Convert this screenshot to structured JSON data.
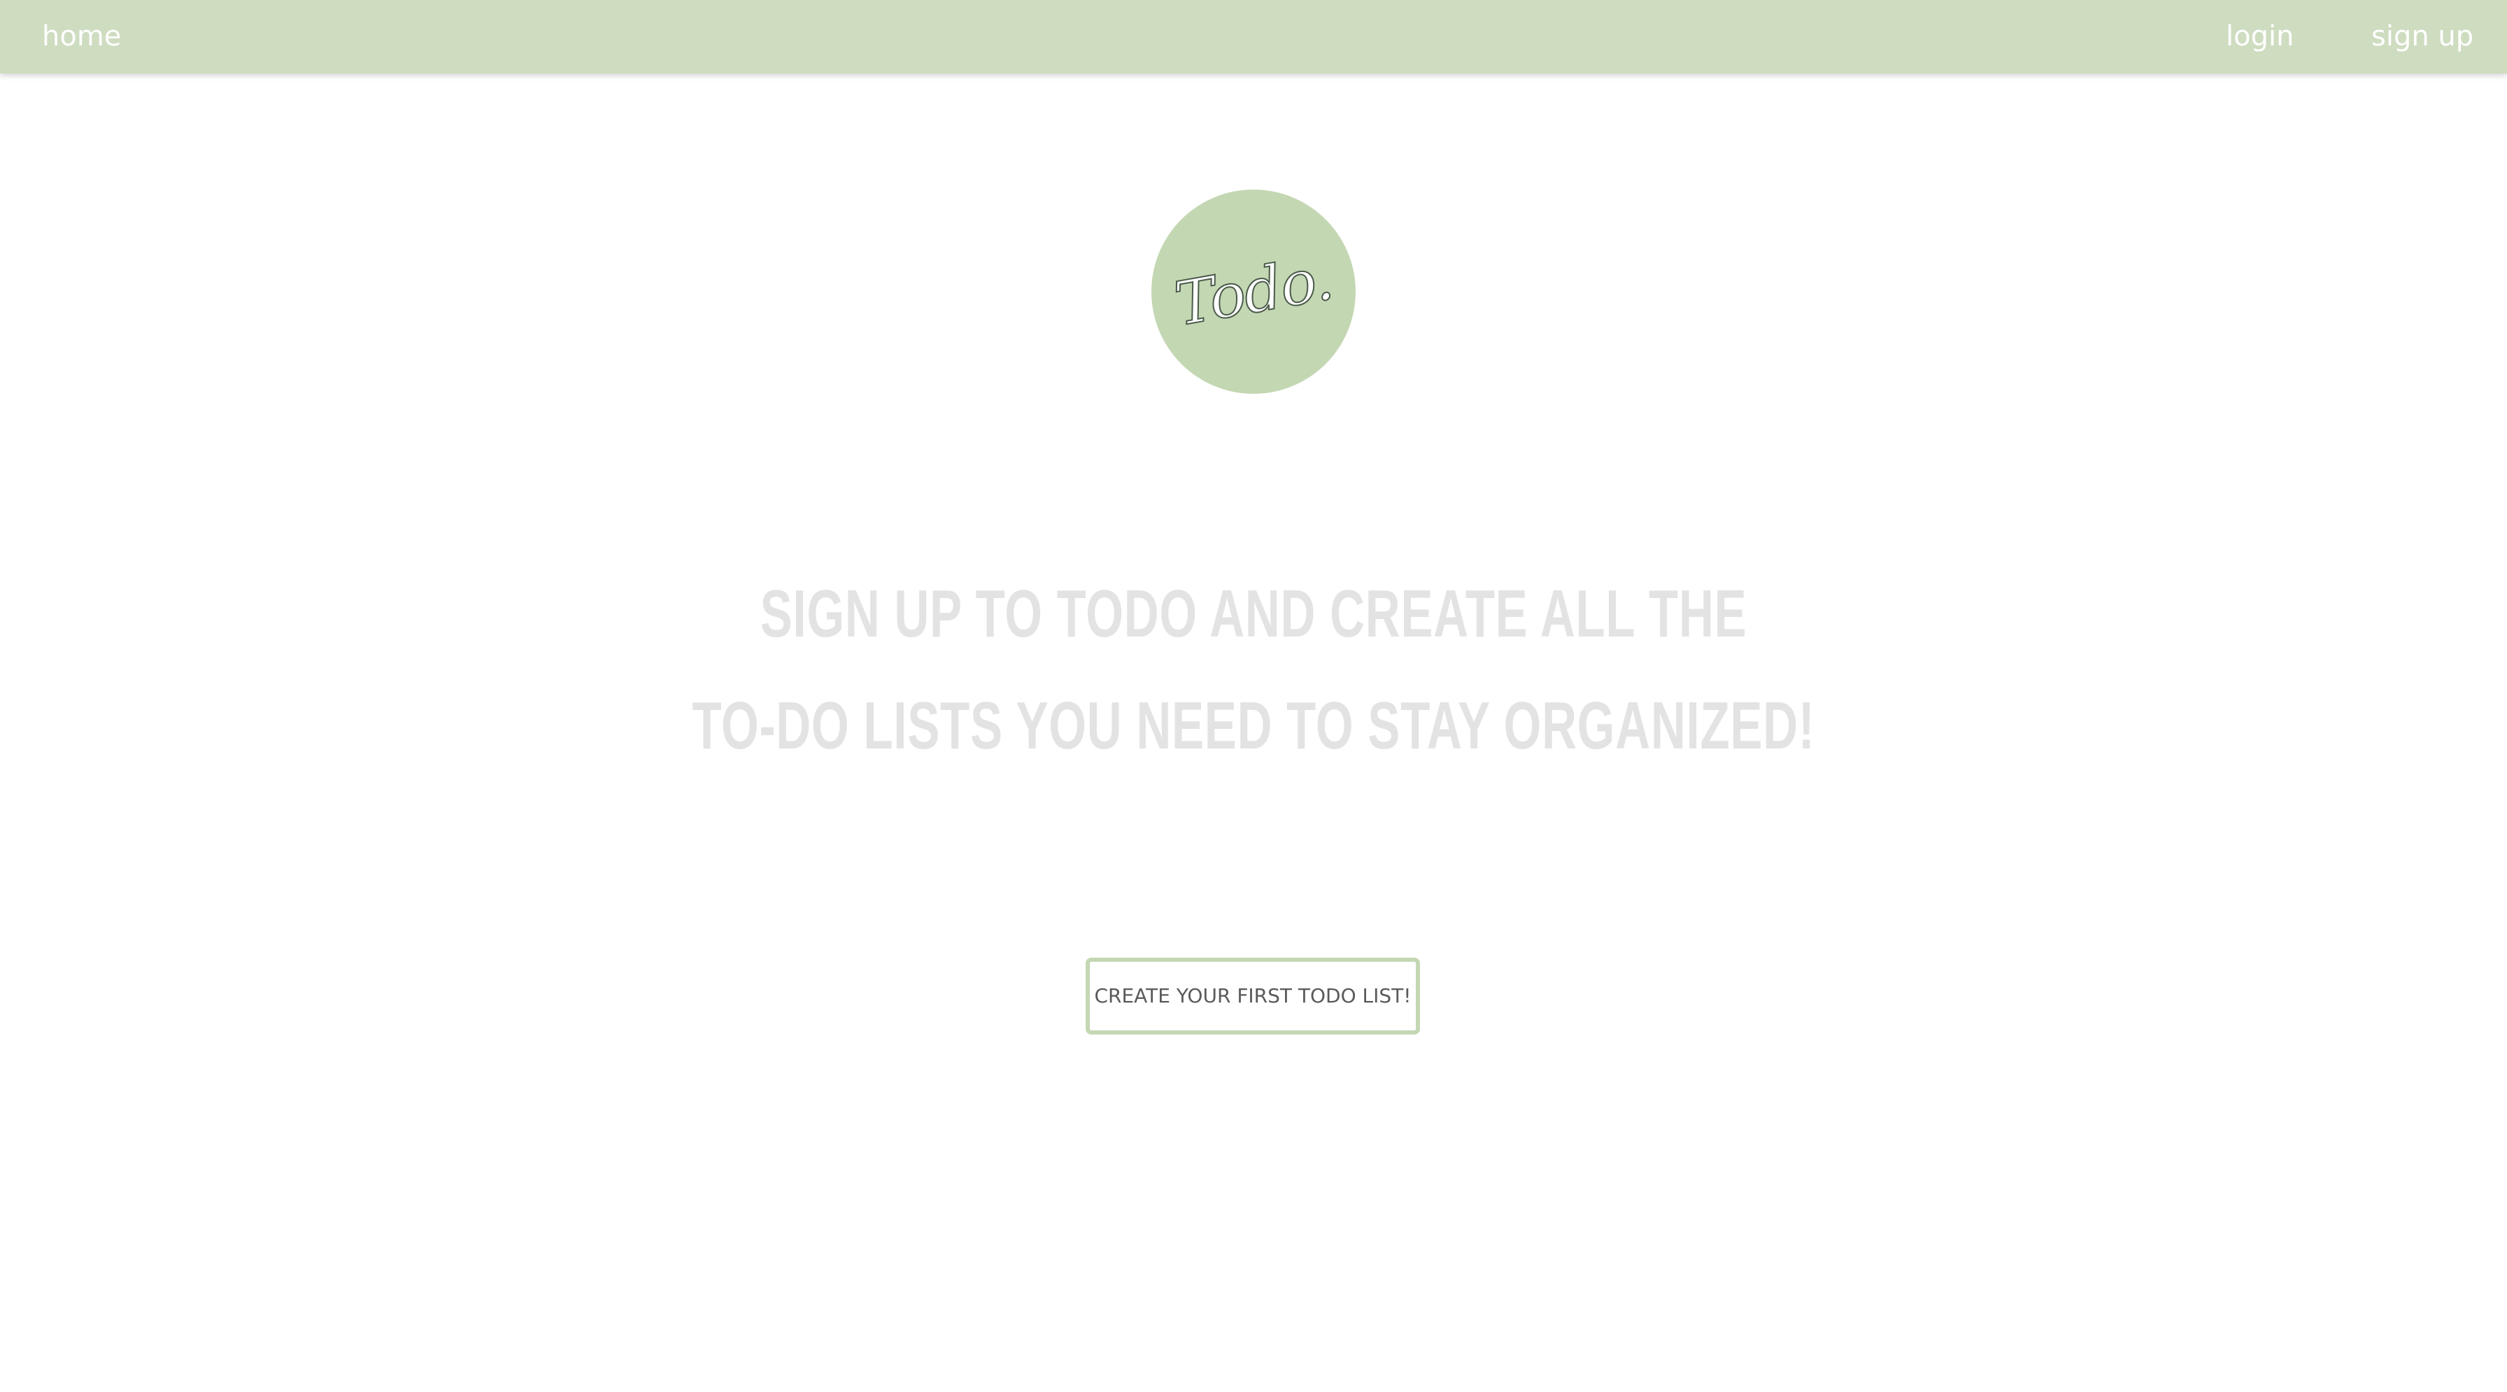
{
  "nav": {
    "home": "home",
    "login": "login",
    "signup": "sign up"
  },
  "logo": {
    "text": "Todo."
  },
  "headline": {
    "line1": "SIGN UP TO TODO AND CREATE ALL THE",
    "line2": "TO-DO LISTS YOU NEED TO STAY ORGANIZED!"
  },
  "cta": {
    "label": "CREATE YOUR FIRST TODO LIST!"
  },
  "colors": {
    "nav_bg": "#cedcc0",
    "accent": "#c4d7b3",
    "headline": "#e3e3e3",
    "button_text": "#5a5a5a"
  }
}
